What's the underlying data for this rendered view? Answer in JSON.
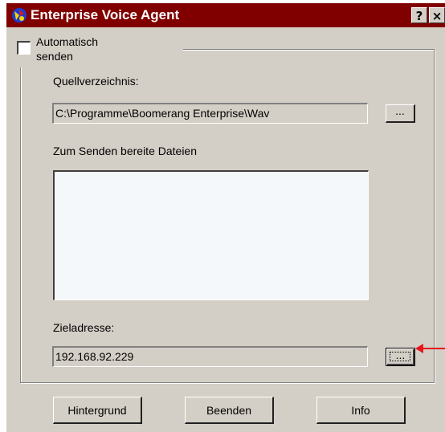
{
  "window": {
    "title": "Enterprise Voice Agent",
    "help_label": "?",
    "close_label": "×"
  },
  "auto_send": {
    "label_line1": "Automatisch",
    "label_line2": "senden",
    "checked": false
  },
  "source": {
    "label": "Quellverzeichnis:",
    "value": "C:\\Programme\\Boomerang Enterprise\\Wav",
    "browse_label": "..."
  },
  "files": {
    "label": "Zum Senden bereite Dateien",
    "items": []
  },
  "target": {
    "label": "Zieladresse:",
    "value": "192.168.92.229",
    "browse_label": "..."
  },
  "buttons": {
    "background": "Hintergrund",
    "quit": "Beenden",
    "info": "Info"
  },
  "colors": {
    "titlebar": "#800000",
    "dialog": "#d4cfc6",
    "annotation_arrow": "#e8141c"
  }
}
